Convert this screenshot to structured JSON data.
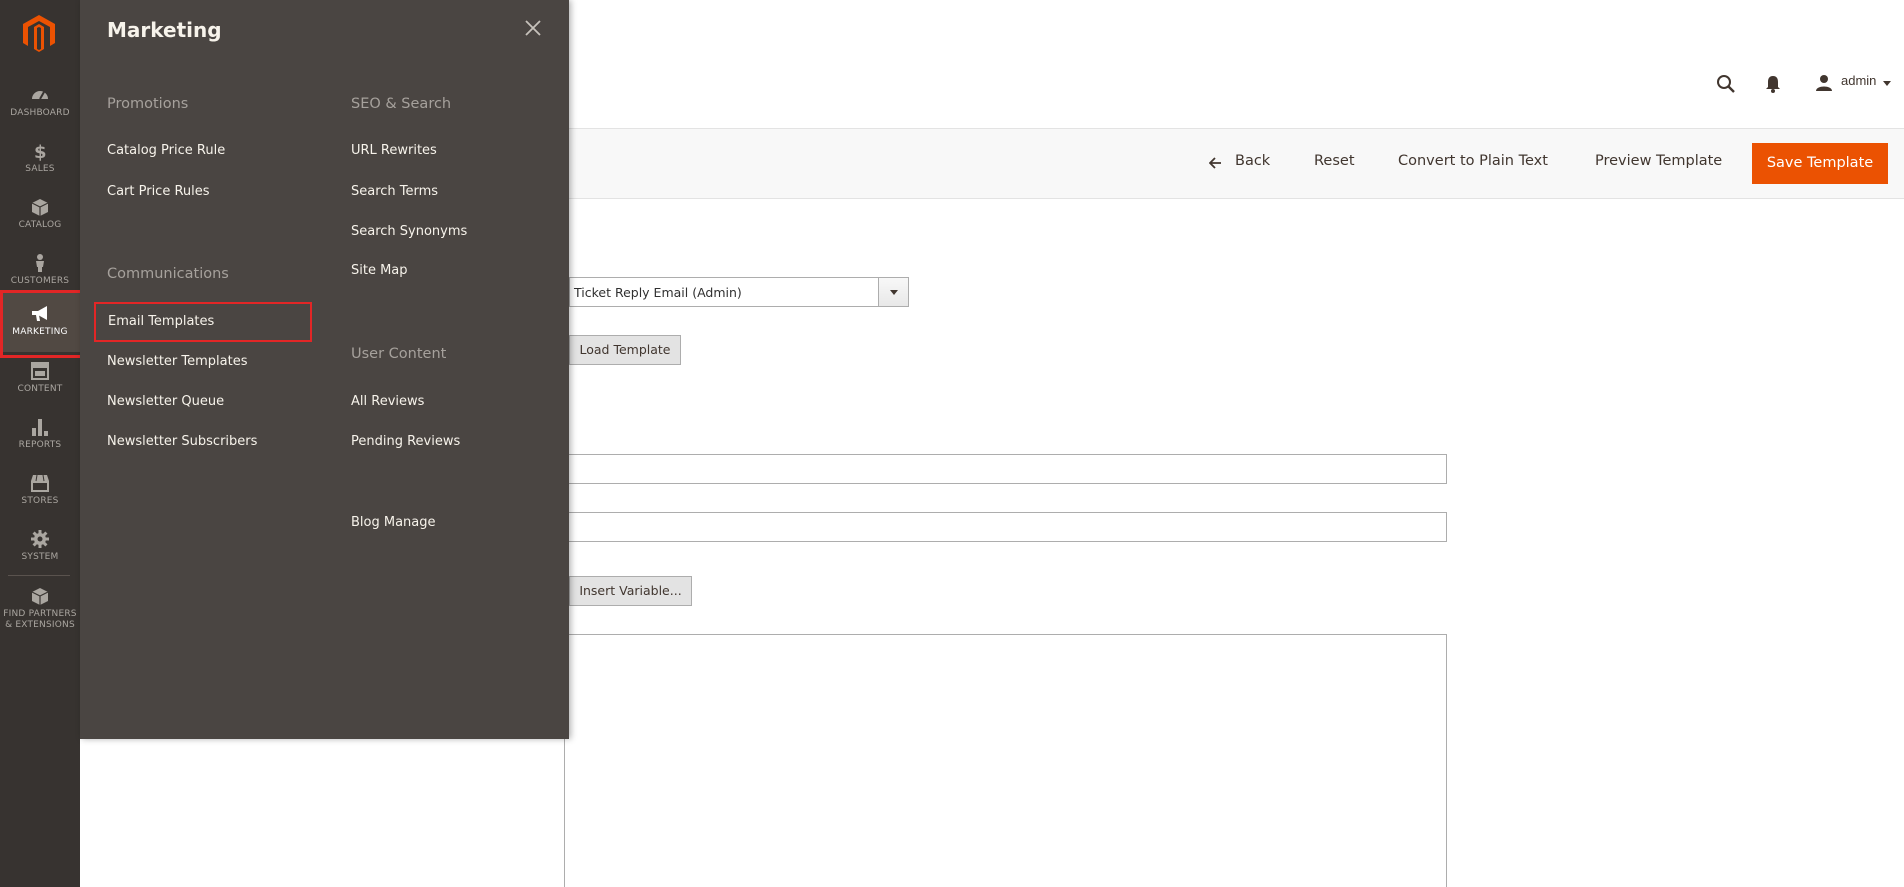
{
  "nav": {
    "items": [
      {
        "label": "DASHBOARD",
        "icon": "dashboard-icon"
      },
      {
        "label": "SALES",
        "icon": "dollar-icon"
      },
      {
        "label": "CATALOG",
        "icon": "box-icon"
      },
      {
        "label": "CUSTOMERS",
        "icon": "person-icon"
      },
      {
        "label": "MARKETING",
        "icon": "megaphone-icon",
        "active": true
      },
      {
        "label": "CONTENT",
        "icon": "layout-icon"
      },
      {
        "label": "REPORTS",
        "icon": "bar-chart-icon"
      },
      {
        "label": "STORES",
        "icon": "storefront-icon"
      },
      {
        "label": "SYSTEM",
        "icon": "gear-icon"
      },
      {
        "label": "FIND PARTNERS",
        "label2": "& EXTENSIONS",
        "icon": "cube-icon"
      }
    ]
  },
  "flyout": {
    "title": "Marketing",
    "col1": {
      "promotions": {
        "heading": "Promotions",
        "links": [
          "Catalog Price Rule",
          "Cart Price Rules"
        ]
      },
      "communications": {
        "heading": "Communications",
        "links": [
          "Email Templates",
          "Newsletter Templates",
          "Newsletter Queue",
          "Newsletter Subscribers"
        ]
      }
    },
    "col2": {
      "seo": {
        "heading": "SEO & Search",
        "links": [
          "URL Rewrites",
          "Search Terms",
          "Search Synonyms",
          "Site Map"
        ]
      },
      "user_content": {
        "heading": "User Content",
        "links": [
          "All Reviews",
          "Pending Reviews"
        ]
      },
      "blog": {
        "links": [
          "Blog Manage"
        ]
      }
    }
  },
  "header": {
    "user": "admin"
  },
  "actions": {
    "back": "Back",
    "reset": "Reset",
    "convert": "Convert to Plain Text",
    "preview": "Preview Template",
    "save": "Save Template"
  },
  "form": {
    "template_select": "Ticket Reply Email (Admin)",
    "load_template": "Load Template",
    "insert_variable": "Insert Variable..."
  },
  "colors": {
    "accent": "#eb5202",
    "nav_bg": "#373330",
    "flyout_bg": "#4a4542",
    "highlight": "#e22626"
  }
}
